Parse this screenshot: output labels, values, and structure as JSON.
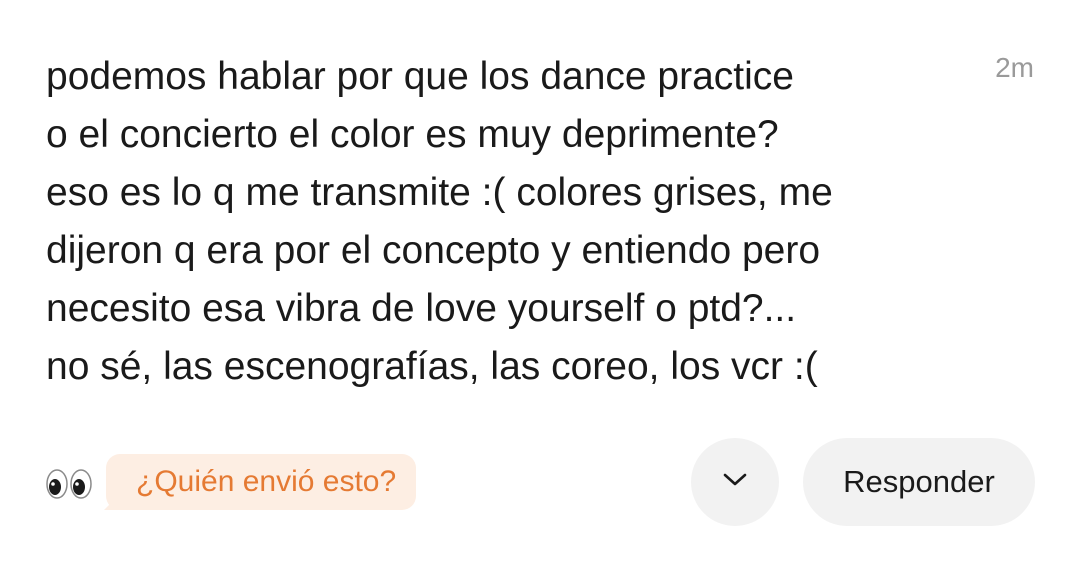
{
  "message": {
    "text": "podemos hablar por que los dance practice\no el concierto el color es muy deprimente?\neso es lo q me transmite :( colores grises, me\ndijeron q era por el concepto y entiendo pero\nnecesito esa vibra de love yourself o ptd?...\nno sé, las escenografías, las coreo, los vcr :(",
    "timestamp": "2m"
  },
  "footer": {
    "reaction_icon": "eyes-emoji",
    "who_sent_label": "¿Quién envió esto?",
    "expand_icon": "chevron-down-icon",
    "reply_label": "Responder"
  },
  "colors": {
    "accent": "#e57a33",
    "accent_bg": "#fdeee3",
    "button_bg": "#f2f2f2",
    "timestamp": "#9a9a9a"
  }
}
